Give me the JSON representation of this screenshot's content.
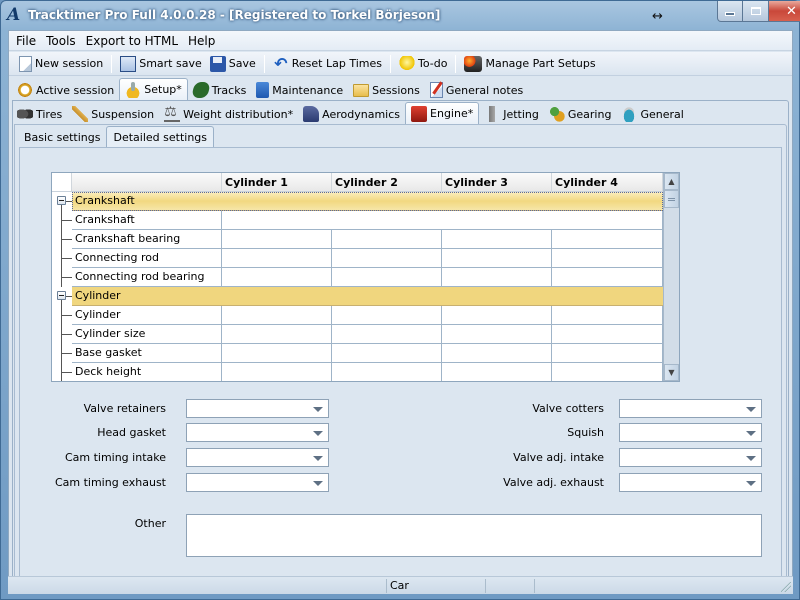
{
  "window": {
    "title": "Tracktimer Pro Full 4.0.0.28  - [Registered to Torkel Börjeson]",
    "app_icon": "tracktimer-logo-icon"
  },
  "menu": [
    "File",
    "Tools",
    "Export to HTML",
    "Help"
  ],
  "toolbar": {
    "new_session": "New session",
    "smart_save": "Smart save",
    "save": "Save",
    "reset_lap_times": "Reset Lap Times",
    "todo": "To-do",
    "manage_part_setups": "Manage Part Setups"
  },
  "main_tabs": [
    {
      "label": "Active session",
      "icon": "stopwatch-icon"
    },
    {
      "label": "Setup*",
      "icon": "setup-icon",
      "active": true
    },
    {
      "label": "Tracks",
      "icon": "track-icon"
    },
    {
      "label": "Maintenance",
      "icon": "maintenance-icon"
    },
    {
      "label": "Sessions",
      "icon": "folder-icon"
    },
    {
      "label": "General notes",
      "icon": "notes-icon"
    }
  ],
  "setup_tabs": [
    {
      "label": "Tires",
      "icon": "tires-icon"
    },
    {
      "label": "Suspension",
      "icon": "suspension-icon"
    },
    {
      "label": "Weight distribution*",
      "icon": "scale-icon"
    },
    {
      "label": "Aerodynamics",
      "icon": "aero-icon"
    },
    {
      "label": "Engine*",
      "icon": "engine-icon",
      "active": true
    },
    {
      "label": "Jetting",
      "icon": "jetting-icon"
    },
    {
      "label": "Gearing",
      "icon": "gearing-icon"
    },
    {
      "label": "General",
      "icon": "general-icon"
    }
  ],
  "engine_tabs": [
    {
      "label": "Basic settings"
    },
    {
      "label": "Detailed settings",
      "active": true
    }
  ],
  "grid": {
    "columns": [
      "",
      "Cylinder 1",
      "Cylinder 2",
      "Cylinder 3",
      "Cylinder 4"
    ],
    "rows": [
      {
        "type": "category",
        "label": "Crankshaft",
        "selected": true
      },
      {
        "type": "item",
        "label": "Crankshaft",
        "merged": true,
        "values": [
          ""
        ]
      },
      {
        "type": "item",
        "label": "Crankshaft bearing",
        "values": [
          "",
          "",
          "",
          ""
        ]
      },
      {
        "type": "item",
        "label": "Connecting rod",
        "values": [
          "",
          "",
          "",
          ""
        ]
      },
      {
        "type": "item",
        "label": "Connecting rod bearing",
        "values": [
          "",
          "",
          "",
          ""
        ]
      },
      {
        "type": "category",
        "label": "Cylinder",
        "selected": false
      },
      {
        "type": "item",
        "label": "Cylinder",
        "values": [
          "",
          "",
          "",
          ""
        ]
      },
      {
        "type": "item",
        "label": "Cylinder size",
        "values": [
          "",
          "",
          "",
          ""
        ]
      },
      {
        "type": "item",
        "label": "Base gasket",
        "values": [
          "",
          "",
          "",
          ""
        ]
      },
      {
        "type": "item",
        "label": "Deck height",
        "values": [
          "",
          "",
          "",
          ""
        ]
      }
    ]
  },
  "fields_left": [
    {
      "label": "Valve retainers",
      "value": ""
    },
    {
      "label": "Head gasket",
      "value": ""
    },
    {
      "label": "Cam timing intake",
      "value": ""
    },
    {
      "label": "Cam timing exhaust",
      "value": ""
    }
  ],
  "fields_right": [
    {
      "label": "Valve cotters",
      "value": ""
    },
    {
      "label": "Squish",
      "value": ""
    },
    {
      "label": "Valve adj. intake",
      "value": ""
    },
    {
      "label": "Valve adj. exhaust",
      "value": ""
    }
  ],
  "other": {
    "label": "Other",
    "value": ""
  },
  "statusbar": {
    "text": "Car"
  },
  "colors": {
    "category_row": "#f0d67e",
    "title_bar": "#8db3d4",
    "close_button": "#c9483a"
  }
}
